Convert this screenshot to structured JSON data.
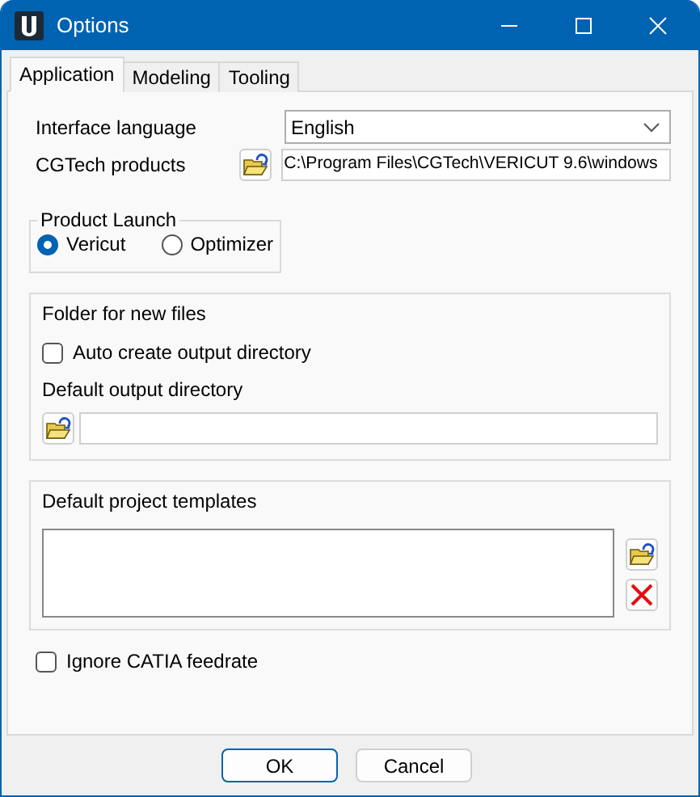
{
  "window": {
    "title": "Options"
  },
  "tabs": [
    {
      "label": "Application",
      "selected": true
    },
    {
      "label": "Modeling",
      "selected": false
    },
    {
      "label": "Tooling",
      "selected": false
    }
  ],
  "interface_language": {
    "label": "Interface language",
    "value": "English"
  },
  "cgtech_products": {
    "label": "CGTech products",
    "value": "C:\\Program Files\\CGTech\\VERICUT 9.6\\windows"
  },
  "product_launch": {
    "title": "Product Launch",
    "options": [
      {
        "label": "Vericut",
        "selected": true
      },
      {
        "label": "Optimizer",
        "selected": false
      }
    ]
  },
  "folder_for_new_files": {
    "title": "Folder for new files",
    "auto_create": {
      "label": "Auto create output directory",
      "checked": false
    },
    "output_label": "Default output directory"
  },
  "default_project_templates": {
    "title": "Default project templates"
  },
  "ignore_catia_feedrate": {
    "label": "Ignore CATIA feedrate",
    "checked": false
  },
  "buttons": [
    {
      "label": "OK",
      "default": true
    },
    {
      "label": "Cancel",
      "default": false
    }
  ]
}
